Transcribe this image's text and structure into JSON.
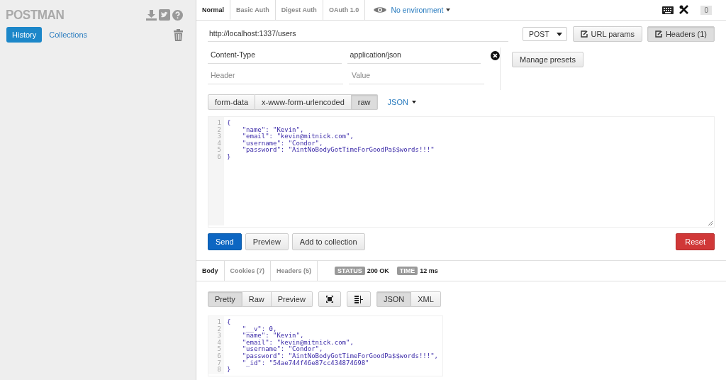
{
  "sidebar": {
    "logo": "POSTMAN",
    "tabs": [
      {
        "label": "History",
        "selected": true
      },
      {
        "label": "Collections",
        "selected": false
      }
    ]
  },
  "request_tabs": [
    {
      "label": "Normal",
      "selected": true
    },
    {
      "label": "Basic Auth",
      "selected": false
    },
    {
      "label": "Digest Auth",
      "selected": false
    },
    {
      "label": "OAuth 1.0",
      "selected": false
    }
  ],
  "environment": "No environment",
  "notification_count": "0",
  "url": "http://localhost:1337/users",
  "method": "POST",
  "url_buttons": [
    {
      "label": "URL params",
      "selected": false
    },
    {
      "label": "Headers (1)",
      "selected": true
    }
  ],
  "headers": [
    {
      "key": "Content-Type",
      "value": "application/json"
    }
  ],
  "new_header": {
    "key": {
      "placeholder": "Header"
    },
    "value": {
      "placeholder": "Value"
    }
  },
  "manage_presets": "Manage presets",
  "body_modes": [
    {
      "label": "form-data",
      "selected": false
    },
    {
      "label": "x-www-form-urlencoded",
      "selected": false
    },
    {
      "label": "raw",
      "selected": true
    }
  ],
  "body_format": "JSON",
  "request_body": [
    {
      "n": "1",
      "text": "{"
    },
    {
      "n": "2",
      "text": "    \"name\": \"Kevin\","
    },
    {
      "n": "3",
      "text": "    \"email\": \"kevin@mitnick.com\","
    },
    {
      "n": "4",
      "text": "    \"username\": \"Condor\","
    },
    {
      "n": "5",
      "text": "    \"password\": \"AintNoBodyGotTimeForGoodPa$$words!!!\""
    },
    {
      "n": "6",
      "text": "}"
    }
  ],
  "actions": [
    "Send",
    "Preview",
    "Add to collection"
  ],
  "reset": "Reset",
  "response_tabs": [
    {
      "label": "Body",
      "selected": true
    },
    {
      "label": "Cookies (7)",
      "selected": false
    },
    {
      "label": "Headers (5)",
      "selected": false
    }
  ],
  "status": {
    "label": "STATUS",
    "value": "200 OK"
  },
  "time": {
    "label": "TIME",
    "value": "12 ms"
  },
  "view_modes": [
    {
      "label": "Pretty",
      "selected": true
    },
    {
      "label": "Raw",
      "selected": false
    },
    {
      "label": "Preview",
      "selected": false
    }
  ],
  "response_formats": [
    {
      "label": "JSON",
      "selected": true
    },
    {
      "label": "XML",
      "selected": false
    }
  ],
  "response_body": [
    {
      "n": "1",
      "text": "{"
    },
    {
      "n": "2",
      "text": "    \"__v\": 0,"
    },
    {
      "n": "3",
      "text": "    \"name\": \"Kevin\","
    },
    {
      "n": "4",
      "text": "    \"email\": \"kevin@mitnick.com\","
    },
    {
      "n": "5",
      "text": "    \"username\": \"Condor\","
    },
    {
      "n": "6",
      "text": "    \"password\": \"AintNoBodyGotTimeForGoodPa$$words!!!\","
    },
    {
      "n": "7",
      "text": "    \"_id\": \"54ae744f46e87cc434874698\""
    },
    {
      "n": "8",
      "text": "}"
    }
  ]
}
